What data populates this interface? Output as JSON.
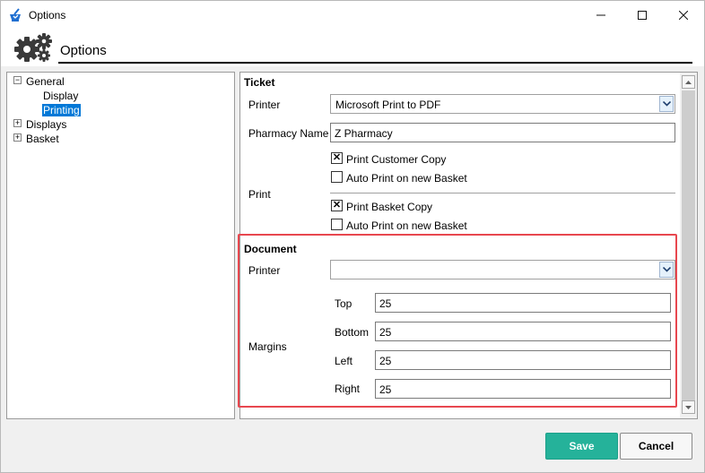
{
  "window": {
    "title": "Options",
    "controls": {
      "minimize_icon": "minimize-icon",
      "maximize_icon": "maximize-icon",
      "close_icon": "close-icon"
    }
  },
  "header": {
    "title": "Options",
    "icon": "gears-icon"
  },
  "tree": {
    "nodes": [
      {
        "label": "General",
        "expander": "−",
        "expanded": true
      },
      {
        "label": "Display"
      },
      {
        "label": "Printing",
        "selected": true
      },
      {
        "label": "Displays",
        "expander": "+",
        "expanded": false
      },
      {
        "label": "Basket",
        "expander": "+",
        "expanded": false
      }
    ]
  },
  "ticket": {
    "title": "Ticket",
    "printer_label": "Printer",
    "printer_value": "Microsoft Print to PDF",
    "pharmacy_label": "Pharmacy Name",
    "pharmacy_value": "Z Pharmacy",
    "print_label": "Print",
    "print_customer_copy": {
      "label": "Print Customer Copy",
      "checked": true
    },
    "auto_print_1": {
      "label": "Auto Print on new Basket",
      "checked": false
    },
    "print_basket_copy": {
      "label": "Print Basket Copy",
      "checked": true
    },
    "auto_print_2": {
      "label": "Auto Print on new Basket",
      "checked": false
    }
  },
  "document": {
    "title": "Document",
    "printer_label": "Printer",
    "printer_value": "",
    "margins_label": "Margins",
    "top_label": "Top",
    "top_value": "25",
    "bottom_label": "Bottom",
    "bottom_value": "25",
    "left_label": "Left",
    "left_value": "25",
    "right_label": "Right",
    "right_value": "25"
  },
  "footer": {
    "save_label": "Save",
    "cancel_label": "Cancel"
  },
  "colors": {
    "accent": "#25b29a",
    "selection": "#0078d7",
    "highlight": "#e8474f"
  }
}
